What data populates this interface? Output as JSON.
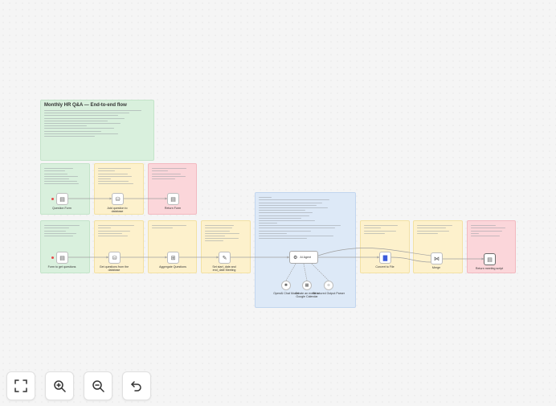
{
  "board": {
    "title": "Monthly HR Q&A — End-to-end flow"
  },
  "nodes": {
    "question_form": "Question Form",
    "add_questions": "Add question to database",
    "return_form": "Return Form",
    "form_get_questions": "Form to get questions",
    "get_questions_db": "Get questions from the database",
    "aggregate_questions": "Aggregate Questions",
    "set_start_end": "Set start_date and end_date Meeting",
    "ai_agent": "AI Agent",
    "openai_chat": "OpenAI Chat Model",
    "create_calendar": "Create an event in Google Calendar",
    "structured_output": "Structured Output Parser",
    "convert_file": "Convert to File",
    "merge": "Merge",
    "return_meeting": "Return meeting script"
  },
  "controls": {
    "fit": "fit-view",
    "zoom_in": "zoom-in",
    "zoom_out": "zoom-out",
    "undo": "undo"
  }
}
